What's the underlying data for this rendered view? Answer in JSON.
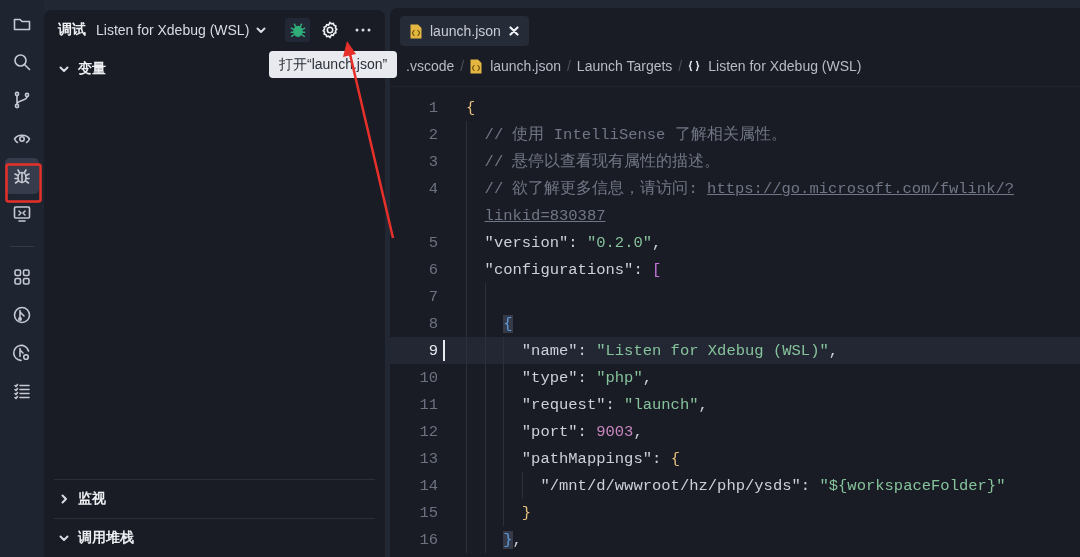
{
  "activity_bar": {
    "groups": [
      [
        {
          "selected": false
        },
        {
          "selected": false
        },
        {
          "selected": false
        },
        {
          "selected": false
        },
        {
          "selected": true
        },
        {
          "selected": false
        }
      ],
      [
        {
          "selected": false
        },
        {
          "selected": false
        },
        {
          "selected": false
        },
        {
          "selected": false
        }
      ]
    ]
  },
  "sidebar": {
    "title": "调试",
    "config": "Listen for Xdebug (WSL)",
    "sections": [
      {
        "label": "变量",
        "expanded": true
      },
      {
        "label": "监视",
        "expanded": false
      },
      {
        "label": "调用堆栈",
        "expanded": true
      }
    ]
  },
  "tooltip": "打开“launch.json”",
  "tabs": [
    {
      "label": "launch.json",
      "selected": true
    }
  ],
  "breadcrumb": {
    "separator": "/",
    "items": [
      {
        "label": ".vscode",
        "kind": "folder"
      },
      {
        "label": "launch.json",
        "kind": "file"
      },
      {
        "label": "Launch Targets",
        "kind": "plain"
      },
      {
        "label": "Listen for Xdebug (WSL)",
        "kind": "object"
      }
    ]
  },
  "editor": {
    "lines": [
      {
        "number": "1",
        "current": false,
        "tokens": [
          {
            "kind": "open",
            "text": "{",
            "matched": false
          }
        ]
      },
      {
        "number": "2",
        "current": false,
        "tokens": [
          {
            "kind": "comment",
            "text": "// 使用 IntelliSense 了解相关属性。"
          }
        ]
      },
      {
        "number": "3",
        "current": false,
        "tokens": [
          {
            "kind": "comment",
            "text": "// 悬停以查看现有属性的描述。"
          }
        ]
      },
      {
        "number": "4",
        "current": false,
        "tokens": [
          {
            "kind": "comment",
            "text": "// 欲了解更多信息，请访问: "
          },
          {
            "kind": "link",
            "text": "https://go.microsoft.com/fwlink/?"
          }
        ]
      },
      {
        "current": false,
        "tokens": [
          {
            "kind": "link",
            "text": "linkid=830387"
          }
        ]
      },
      {
        "number": "5",
        "current": false,
        "tokens": [
          {
            "kind": "key",
            "text": "\"version\""
          },
          {
            "kind": "punct",
            "text": ": "
          },
          {
            "kind": "string",
            "text": "\"0.2.0\""
          },
          {
            "kind": "punct",
            "text": ","
          }
        ]
      },
      {
        "number": "6",
        "current": false,
        "tokens": [
          {
            "kind": "key",
            "text": "\"configurations\""
          },
          {
            "kind": "punct",
            "text": ": "
          },
          {
            "kind": "open",
            "text": "[",
            "matched": false
          }
        ]
      },
      {
        "number": "7",
        "current": false
      },
      {
        "number": "8",
        "current": false,
        "tokens": [
          {
            "kind": "open",
            "text": "{",
            "matched": true
          }
        ]
      },
      {
        "number": "9",
        "current": true,
        "tokens": [
          {
            "kind": "key",
            "text": "\"name\""
          },
          {
            "kind": "punct",
            "text": ": "
          },
          {
            "kind": "string",
            "text": "\"Listen for Xdebug (WSL)\""
          },
          {
            "kind": "punct",
            "text": ","
          }
        ]
      },
      {
        "number": "10",
        "current": false,
        "tokens": [
          {
            "kind": "key",
            "text": "\"type\""
          },
          {
            "kind": "punct",
            "text": ": "
          },
          {
            "kind": "string",
            "text": "\"php\""
          },
          {
            "kind": "punct",
            "text": ","
          }
        ]
      },
      {
        "number": "11",
        "current": false,
        "tokens": [
          {
            "kind": "key",
            "text": "\"request\""
          },
          {
            "kind": "punct",
            "text": ": "
          },
          {
            "kind": "string",
            "text": "\"launch\""
          },
          {
            "kind": "punct",
            "text": ","
          }
        ]
      },
      {
        "number": "12",
        "current": false,
        "tokens": [
          {
            "kind": "key",
            "text": "\"port\""
          },
          {
            "kind": "punct",
            "text": ": "
          },
          {
            "kind": "number",
            "text": "9003"
          },
          {
            "kind": "punct",
            "text": ","
          }
        ]
      },
      {
        "number": "13",
        "current": false,
        "tokens": [
          {
            "kind": "key",
            "text": "\"pathMappings\""
          },
          {
            "kind": "punct",
            "text": ": "
          },
          {
            "kind": "open",
            "text": "{",
            "matched": false
          }
        ]
      },
      {
        "number": "14",
        "current": false,
        "tokens": [
          {
            "kind": "key",
            "text": "\"/mnt/d/wwwroot/hz/php/ysds\""
          },
          {
            "kind": "punct",
            "text": ": "
          },
          {
            "kind": "string",
            "text": "\"${workspaceFolder}\""
          }
        ]
      },
      {
        "number": "15",
        "current": false,
        "tokens": [
          {
            "kind": "close",
            "text": "}",
            "matched": false
          }
        ]
      },
      {
        "number": "16",
        "current": false,
        "tokens": [
          {
            "kind": "close",
            "text": "}",
            "matched": true
          },
          {
            "kind": "punct",
            "text": ","
          }
        ]
      }
    ]
  }
}
